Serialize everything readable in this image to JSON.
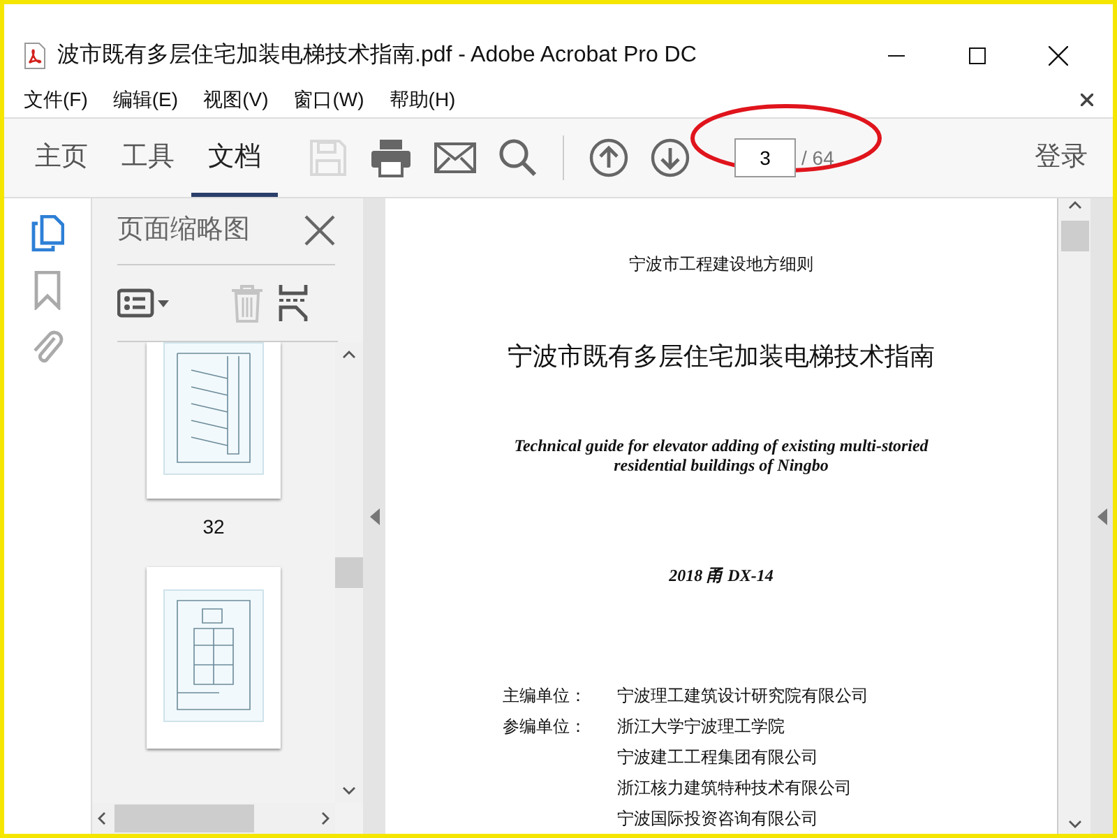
{
  "window": {
    "title": "波市既有多层住宅加装电梯技术指南.pdf - Adobe Acrobat Pro DC"
  },
  "menu": [
    "文件(F)",
    "编辑(E)",
    "视图(V)",
    "窗口(W)",
    "帮助(H)"
  ],
  "tabs": [
    {
      "label": "主页",
      "selected": false
    },
    {
      "label": "工具",
      "selected": false
    },
    {
      "label": "文档",
      "selected": true
    }
  ],
  "toolbar": {
    "tools": [
      {
        "kind": "save",
        "disabled": true
      },
      {
        "kind": "print",
        "disabled": false
      },
      {
        "kind": "mail",
        "disabled": false
      },
      {
        "kind": "search",
        "disabled": false
      },
      {
        "kind": "divider"
      },
      {
        "kind": "up",
        "disabled": false
      },
      {
        "kind": "down",
        "disabled": false
      }
    ],
    "page_current": "3",
    "page_total": "/ 64",
    "sign_in": "登录"
  },
  "side_rail": [
    {
      "kind": "pages",
      "selected": true
    },
    {
      "kind": "bookmarks",
      "selected": false
    },
    {
      "kind": "attachments",
      "selected": false
    }
  ],
  "thumbnail_panel": {
    "title": "页面缩略图",
    "tools": [
      {
        "kind": "options",
        "disabled": false
      },
      {
        "kind": "delete",
        "disabled": true
      },
      {
        "kind": "extract",
        "disabled": false
      }
    ],
    "thumbnails": [
      {
        "kind": "elevation",
        "label": "32"
      },
      {
        "kind": "plan"
      }
    ]
  },
  "document": {
    "series": "宁波市工程建设地方细则",
    "title": "宁波市既有多层住宅加装电梯技术指南",
    "title_en": [
      "Technical guide for elevator adding of existing multi-storied",
      "residential buildings of Ningbo"
    ],
    "code": "2018 甬  DX-14",
    "units": [
      {
        "role": "主编单位：",
        "name": "宁波理工建筑设计研究院有限公司"
      },
      {
        "role": "参编单位：",
        "name": "浙江大学宁波理工学院"
      },
      {
        "name": "宁波建工工程集团有限公司"
      },
      {
        "name": "浙江核力建筑特种技术有限公司"
      },
      {
        "name": "宁波国际投资咨询有限公司"
      }
    ]
  }
}
